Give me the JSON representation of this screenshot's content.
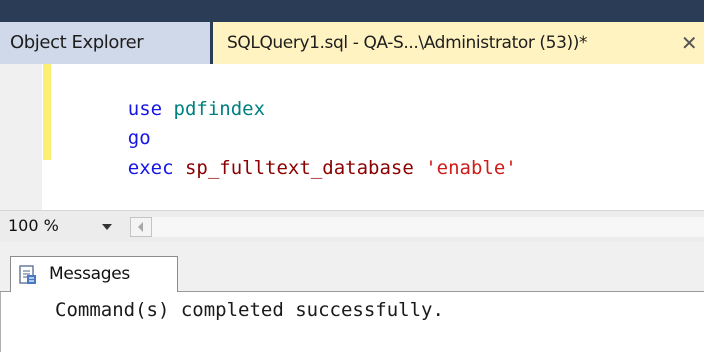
{
  "tabs": {
    "object_explorer": "Object Explorer",
    "query": "SQLQuery1.sql - QA-S...\\Administrator (53))*",
    "close_glyph": "✕"
  },
  "editor": {
    "lines": [
      [
        {
          "text": "use",
          "role": "keyword"
        },
        {
          "text": " "
        },
        {
          "text": "pdfindex",
          "role": "identifier"
        }
      ],
      [
        {
          "text": "go",
          "role": "keyword"
        }
      ],
      [
        {
          "text": "exec",
          "role": "keyword"
        },
        {
          "text": " "
        },
        {
          "text": "sp_fulltext_database",
          "role": "procedure"
        },
        {
          "text": " "
        },
        {
          "text": "'enable'",
          "role": "string"
        }
      ]
    ]
  },
  "zoom": {
    "value": "100 %"
  },
  "results": {
    "tab_label": "Messages",
    "message": "Command(s) completed successfully."
  },
  "colors": {
    "tabstrip_bg": "#2b3c57",
    "active_tab_bg": "#fff3c1",
    "inactive_tab_bg": "#cfd9ea",
    "keyword": "#1515e6",
    "identifier": "#008080",
    "procedure": "#8b0000",
    "string": "#d11a1a",
    "changebar": "#fcef73"
  },
  "icons": {
    "close": "close-icon",
    "zoom_dropdown": "chevron-down-icon",
    "scroll_left": "scroll-left-arrow-icon",
    "messages": "messages-icon"
  }
}
